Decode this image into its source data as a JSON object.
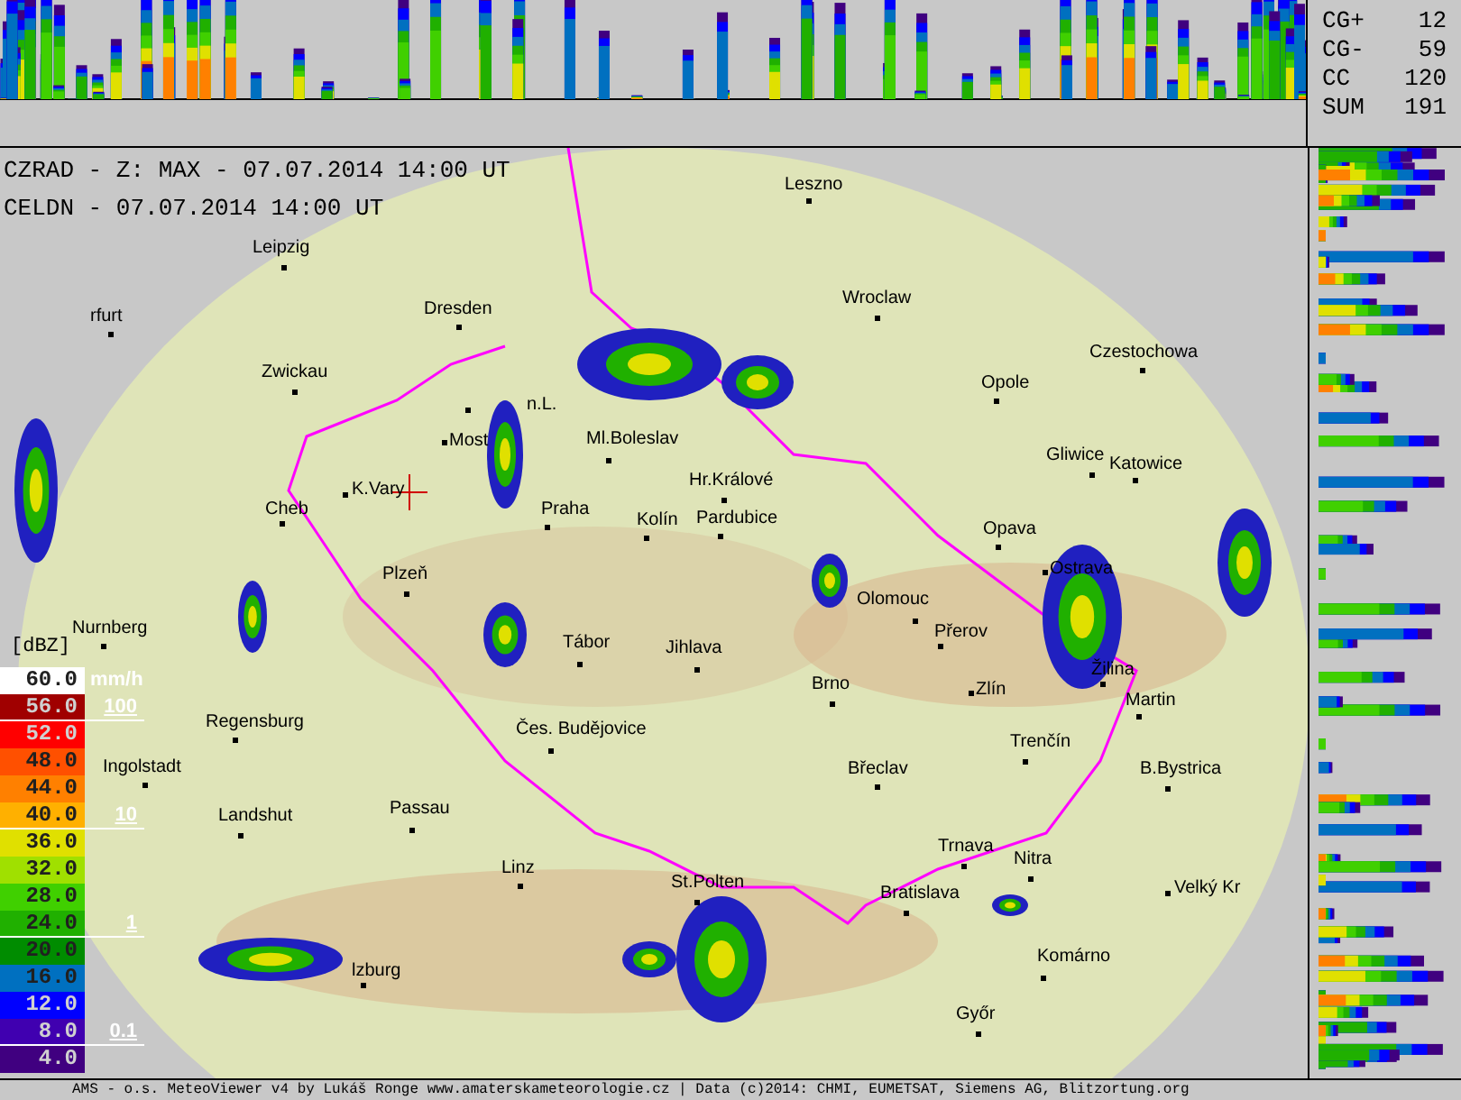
{
  "header_lines": [
    "CZRAD - Z: MAX - 07.07.2014 14:00 UT",
    "CELDN - 07.07.2014 14:00 UT"
  ],
  "lightning_stats": [
    {
      "label": "CG+",
      "value": "12"
    },
    {
      "label": "CG-",
      "value": "59"
    },
    {
      "label": "CC",
      "value": "120"
    },
    {
      "label": "SUM",
      "value": "191"
    }
  ],
  "legend": {
    "unit": "[dBZ]",
    "levels": [
      {
        "value": "60.0",
        "color": "#ffffff"
      },
      {
        "value": "56.0",
        "color": "#a00000"
      },
      {
        "value": "52.0",
        "color": "#ff0000"
      },
      {
        "value": "48.0",
        "color": "#ff5000"
      },
      {
        "value": "44.0",
        "color": "#ff8000"
      },
      {
        "value": "40.0",
        "color": "#ffb000"
      },
      {
        "value": "36.0",
        "color": "#e0e000"
      },
      {
        "value": "32.0",
        "color": "#a0e000"
      },
      {
        "value": "28.0",
        "color": "#40d000"
      },
      {
        "value": "24.0",
        "color": "#20b000"
      },
      {
        "value": "20.0",
        "color": "#008c00"
      },
      {
        "value": "16.0",
        "color": "#0070c0"
      },
      {
        "value": "12.0",
        "color": "#0000ff"
      },
      {
        "value": "8.0",
        "color": "#4000b0"
      },
      {
        "value": "4.0",
        "color": "#400080"
      }
    ],
    "rain_unit": "mm/h",
    "rain_marks": [
      "100",
      "10",
      "1",
      "0.1"
    ]
  },
  "cities": [
    {
      "name": "Leszno"
    },
    {
      "name": "Leipzig"
    },
    {
      "name": "Wroclaw"
    },
    {
      "name": "rfurt"
    },
    {
      "name": "Dresden"
    },
    {
      "name": "Czestochowa"
    },
    {
      "name": "Zwickau"
    },
    {
      "name": "Opole"
    },
    {
      "name": "n.L."
    },
    {
      "name": "Most"
    },
    {
      "name": "Ml.Boleslav"
    },
    {
      "name": "Gliwice"
    },
    {
      "name": "Katowice"
    },
    {
      "name": "Hr.Králové"
    },
    {
      "name": "K.Vary"
    },
    {
      "name": "Cheb"
    },
    {
      "name": "Praha"
    },
    {
      "name": "Kolín"
    },
    {
      "name": "Pardubice"
    },
    {
      "name": "Opava"
    },
    {
      "name": "Ostrava"
    },
    {
      "name": "Plzeň"
    },
    {
      "name": "Olomouc"
    },
    {
      "name": "Nurnberg"
    },
    {
      "name": "Přerov"
    },
    {
      "name": "Tábor"
    },
    {
      "name": "Jihlava"
    },
    {
      "name": "Žilina"
    },
    {
      "name": "Brno"
    },
    {
      "name": "Zlín"
    },
    {
      "name": "Martin"
    },
    {
      "name": "Regensburg"
    },
    {
      "name": "Čes. Budějovice"
    },
    {
      "name": "Trenčín"
    },
    {
      "name": "Ingolstadt"
    },
    {
      "name": "Břeclav"
    },
    {
      "name": "B.Bystrica"
    },
    {
      "name": "Passau"
    },
    {
      "name": "Landshut"
    },
    {
      "name": "Trnava"
    },
    {
      "name": "Nitra"
    },
    {
      "name": "Linz"
    },
    {
      "name": "St.Polten"
    },
    {
      "name": "Bratislava"
    },
    {
      "name": "Velký Kr"
    },
    {
      "name": "Komárno"
    },
    {
      "name": "lzburg"
    },
    {
      "name": "Győr"
    }
  ],
  "footer": "AMS - o.s. MeteoViewer v4 by Lukáš Ronge www.amaterskameteorologie.cz | Data (c)2014: CHMI, EUMETSAT, Siemens AG, Blitzortung.org"
}
